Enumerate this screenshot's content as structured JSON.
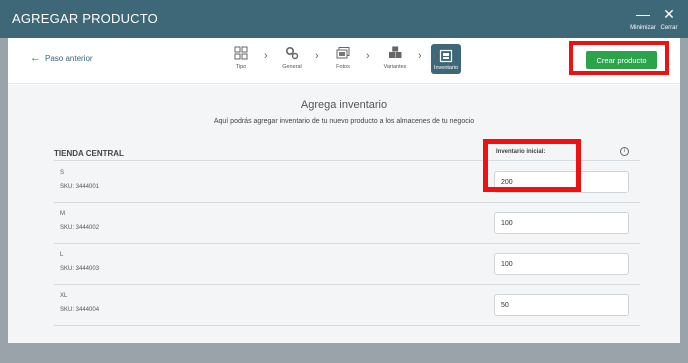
{
  "window": {
    "title": "AGREGAR PRODUCTO",
    "minimize_label": "Minimizar",
    "close_label": "Cerrar"
  },
  "nav": {
    "back_label": "Paso anterior",
    "steps": [
      {
        "label": "Tipo",
        "icon": "grid-icon"
      },
      {
        "label": "General",
        "icon": "gears-icon"
      },
      {
        "label": "Fotos",
        "icon": "photos-icon"
      },
      {
        "label": "Variantes",
        "icon": "boxes-icon"
      },
      {
        "label": "Inventario",
        "icon": "inventory-icon",
        "active": true
      }
    ],
    "create_label": "Crear producto"
  },
  "main": {
    "heading": "Agrega inventario",
    "subheading": "Aquí podrás agregar inventario de tu nuevo producto a los almacenes de tu negocio",
    "store_name": "TIENDA CENTRAL",
    "inventory_label": "Inventario inicial:",
    "rows": [
      {
        "size": "S",
        "sku": "SKU: 3444001",
        "qty": "200"
      },
      {
        "size": "M",
        "sku": "SKU: 3444002",
        "qty": "100"
      },
      {
        "size": "L",
        "sku": "SKU: 3444003",
        "qty": "100"
      },
      {
        "size": "XL",
        "sku": "SKU: 3444004",
        "qty": "50"
      }
    ]
  },
  "colors": {
    "titlebar": "#3e6777",
    "create_button": "#2aa34a",
    "highlight": "#ee1111"
  }
}
